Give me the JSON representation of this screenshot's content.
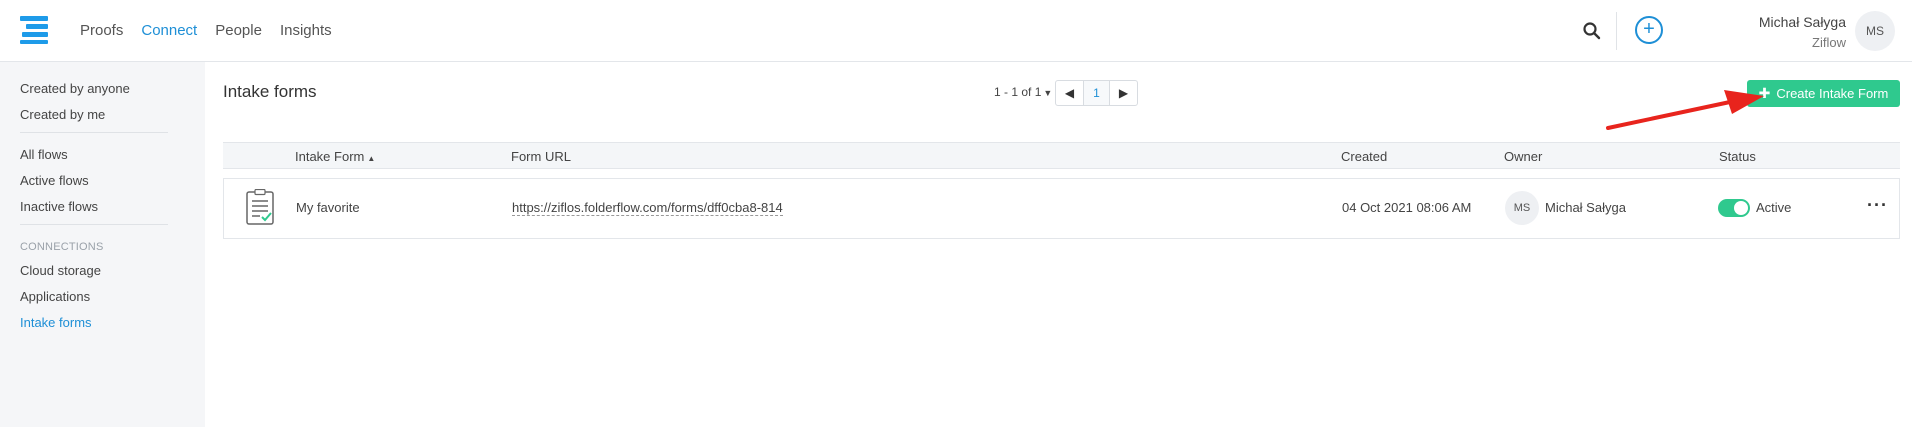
{
  "nav": {
    "items": [
      {
        "label": "Proofs",
        "active": false
      },
      {
        "label": "Connect",
        "active": true
      },
      {
        "label": "People",
        "active": false
      },
      {
        "label": "Insights",
        "active": false
      }
    ]
  },
  "user": {
    "name": "Michał Sałyga",
    "org": "Ziflow",
    "initials": "MS"
  },
  "sidebar": {
    "items_top": [
      "Created by anyone",
      "Created by me"
    ],
    "items_flows": [
      "All flows",
      "Active flows",
      "Inactive flows"
    ],
    "section_label": "CONNECTIONS",
    "items_connections": [
      "Cloud storage",
      "Applications",
      "Intake forms"
    ]
  },
  "main": {
    "title": "Intake forms",
    "pager_text": "1 - 1 of 1",
    "page": "1",
    "create_label": "Create Intake Form"
  },
  "table": {
    "headers": {
      "name": "Intake Form",
      "url": "Form URL",
      "created": "Created",
      "owner": "Owner",
      "status": "Status"
    },
    "rows": [
      {
        "name": "My favorite",
        "url": "https://ziflos.folderflow.com/forms/dff0cba8-814",
        "created": "04 Oct 2021 08:06 AM",
        "owner_initials": "MS",
        "owner": "Michał Sałyga",
        "status": "Active"
      }
    ]
  },
  "colors": {
    "accent": "#1e8fd6",
    "success": "#2fc98e",
    "arrow": "#e8241d"
  },
  "icons": [
    "ziflow-logo",
    "search-icon",
    "add-circle-icon",
    "caret-down-icon",
    "chevron-left-icon",
    "chevron-right-icon",
    "plus-icon",
    "sort-asc-icon",
    "form-document-icon",
    "more-icon"
  ]
}
